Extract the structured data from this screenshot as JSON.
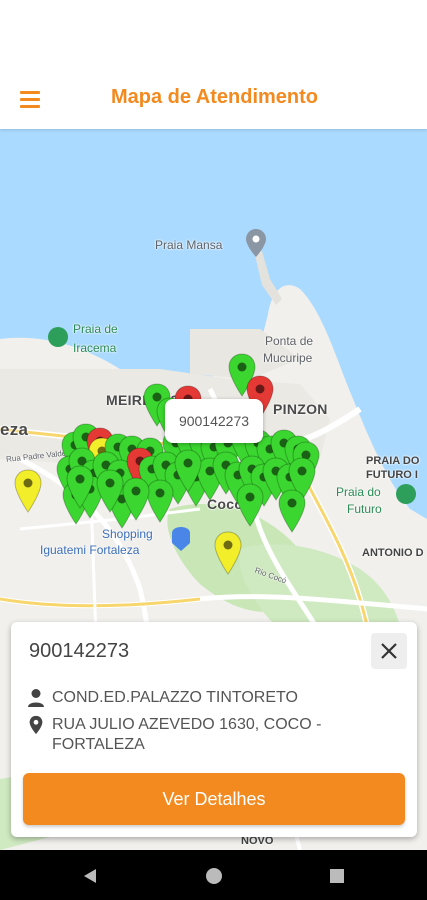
{
  "header": {
    "title": "Mapa de Atendimento",
    "accent_color": "#f28a1f",
    "menu_icon": "hamburger-menu-icon"
  },
  "map": {
    "labels": {
      "praia_mansa": "Praia Mansa",
      "praia_de": "Praia de",
      "iracema": "Iracema",
      "ponta_de": "Ponta de",
      "mucuripe": "Mucuripe",
      "meireles": "MEIRELES",
      "pinzon": "PINZON",
      "eza": "eza",
      "praia_do": "PRAIA DO",
      "futuro_i": "FUTURO I",
      "praia_do_futuro_1": "Praia do",
      "praia_do_futuro_2": "Futuro",
      "coco": "Coco",
      "shopping": "Shopping",
      "iguatemi": "Iguatemi Fortaleza",
      "antonio_d": "ANTONIO D",
      "novo": "NOVO",
      "rua_padre": "Rua Padre Valdevino",
      "rio_coco": "Rio Cocó"
    },
    "pin_colors": {
      "green": "#3bd62f",
      "red": "#e53935",
      "yellow": "#f3ee2a"
    },
    "tooltip": "900142273"
  },
  "card": {
    "id": "900142273",
    "name": "COND.ED.PALAZZO TINTORETO",
    "address_line1": "RUA JULIO AZEVEDO 1630, COCO -",
    "address_line2": "FORTALEZA",
    "button": "Ver Detalhes",
    "close_icon": "close-icon",
    "person_icon": "person-icon",
    "location_icon": "location-pin-icon"
  },
  "navbar": {
    "back_icon": "back-triangle-icon",
    "home_icon": "home-circle-icon",
    "recents_icon": "recents-square-icon"
  }
}
